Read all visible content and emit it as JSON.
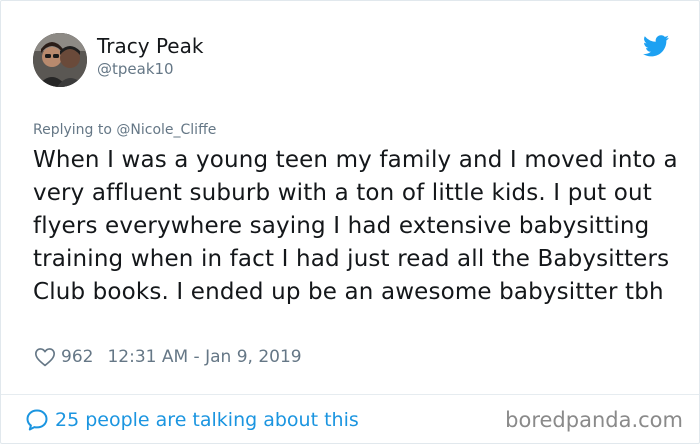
{
  "tweet": {
    "author": {
      "display_name": "Tracy Peak",
      "handle": "@tpeak10",
      "avatar_icon": "profile-photo"
    },
    "platform_icon": "twitter-bird-icon",
    "reply_prefix": "Replying to",
    "reply_to": "@Nicole_Cliffe",
    "text": "When I was a young teen my family and I moved into a very affluent suburb with a ton of little kids. I put out flyers everywhere saying I had extensive babysitting training when in fact I had just read all the Babysitters Club books. I ended up be an awesome babysitter tbh",
    "likes": "962",
    "timestamp": "12:31 AM - Jan 9, 2019",
    "conversation_link": "25 people are talking about this"
  },
  "watermark": "boredpanda.com",
  "colors": {
    "accent": "#1da1f2",
    "link": "#1b95e0",
    "muted": "#657786",
    "text": "#14171a"
  }
}
